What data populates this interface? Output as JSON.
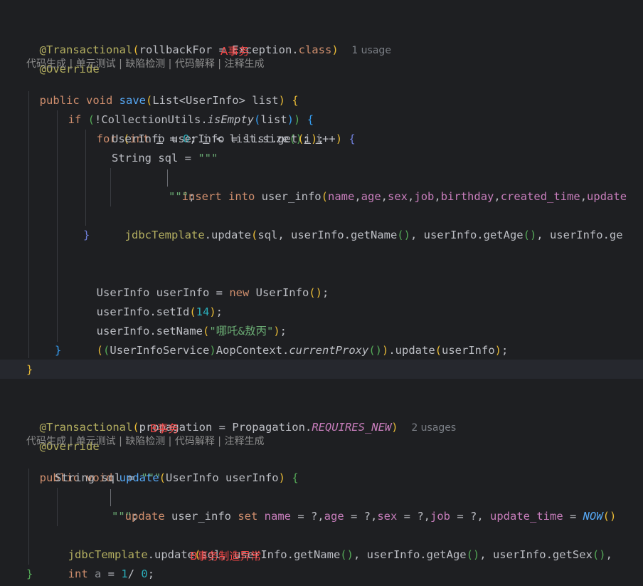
{
  "method_a": {
    "annotation": "@Transactional",
    "annotation_args": "rollbackFor = Exception.class",
    "usage_hint": "1 usage",
    "override": "@Override",
    "ai_actions": "代码生成 | 单元测试 | 缺陷检测 | 代码解释 | 注释生成",
    "note": "A事务",
    "signature": "public void save(List<UserInfo> list) {",
    "l_if": "if (!CollectionUtils.isEmpty(list)) {",
    "l_for": "for (int i = 0; i < list.size(); i++) {",
    "l_get": "UserInfo userInfo = list.get(i);",
    "l_sql": "String sql = \"\"\"",
    "l_insert": "insert into user_info(name,age,sex,job,birthday,created_time,update",
    "l_close_str": "\"\"\";",
    "l_update": "jdbcTemplate.update(sql, userInfo.getName(), userInfo.getAge(), userInfo.ge",
    "l_brace_for": "}",
    "l_new": "UserInfo userInfo = new UserInfo();",
    "l_setid": "userInfo.setId(14);",
    "l_setname": "userInfo.setName(\"哪吒&敖丙\");",
    "l_proxy": "((UserInfoService)AopContext.currentProxy()).update(userInfo);",
    "l_brace_if": "}",
    "l_brace_method": "}"
  },
  "method_b": {
    "annotation": "@Transactional",
    "annotation_args": "propagation = Propagation.REQUIRES_NEW",
    "usage_hint": "2 usages",
    "override": "@Override",
    "ai_actions": "代码生成 | 单元测试 | 缺陷检测 | 代码解释 | 注释生成",
    "note": "B事务",
    "signature": "public void update(UserInfo userInfo) {",
    "l_sql": "String sql = \"\"\"",
    "l_update_sql": "update user_info set name = ?,age = ?,sex = ?,job = ?, update_time = NOW()",
    "l_close_str": "\"\"\";",
    "l_jdbc": "jdbcTemplate.update(sql, userInfo.getName(), userInfo.getAge(), userInfo.getSex(),",
    "l_div": "int a = 1/ 0;",
    "note_exception": "B事务制造异常",
    "l_brace_method": "}"
  },
  "colors": {
    "background": "#1e1f22",
    "keyword": "#cf8e6d",
    "annotation": "#b3ae60",
    "function": "#56a8f5",
    "string": "#6aab73",
    "number": "#2aacb8",
    "note": "#f44747"
  }
}
